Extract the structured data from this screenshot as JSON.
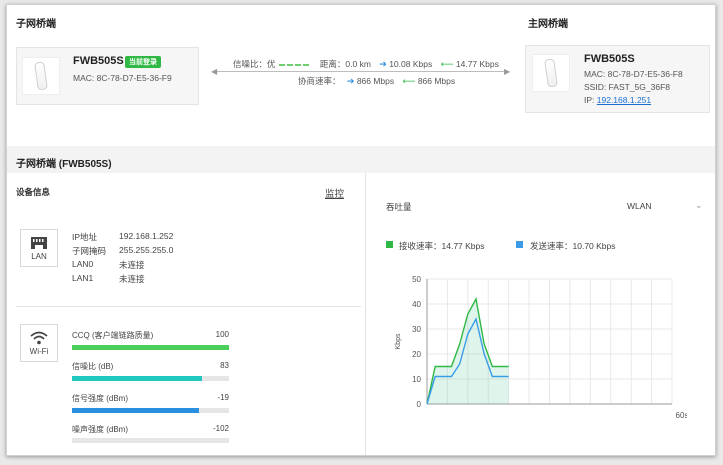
{
  "top": {
    "child_title": "子网桥端",
    "main_title": "主网桥端"
  },
  "child_device": {
    "name": "FWB505S",
    "badge": "当前登录",
    "mac": "MAC: 8C-78-D7-E5-36-F9"
  },
  "main_device": {
    "name": "FWB505S",
    "mac": "MAC: 8C-78-D7-E5-36-F8",
    "ssid": "SSID: FAST_5G_36F8",
    "ip_label": "IP: ",
    "ip_link": "192.168.1.251"
  },
  "connection": {
    "snr_text": "信噪比：优",
    "distance": "距离：0.0 km",
    "tx_rate": "10.08 Kbps",
    "rx_rate": "14.77 Kbps",
    "neg_label": "协商速率：",
    "neg_tx": "866 Mbps",
    "neg_rx": "866 Mbps"
  },
  "section": {
    "title": "子网桥端 (FWB505S)",
    "device_info": "设备信息",
    "monitor_link": "监控"
  },
  "lan": {
    "icon_label": "LAN",
    "rows": [
      {
        "key": "IP地址",
        "value": "192.168.1.252"
      },
      {
        "key": "子网掩码",
        "value": "255.255.255.0"
      },
      {
        "key": "LAN0",
        "value": "未连接"
      },
      {
        "key": "LAN1",
        "value": "未连接"
      }
    ]
  },
  "wifi": {
    "icon_label": "Wi-Fi",
    "metrics": [
      {
        "label": "CCQ (客户端链路质量)",
        "value": "100",
        "fraction": 1.0,
        "color": "#4ccf5a"
      },
      {
        "label": "信噪比 (dB)",
        "value": "83",
        "fraction": 0.83,
        "color": "#21c8bd"
      },
      {
        "label": "信号强度 (dBm)",
        "value": "-19",
        "fraction": 0.81,
        "color": "#2a8fdf"
      },
      {
        "label": "噪声强度 (dBm)",
        "value": "-102",
        "fraction": 0.0,
        "color": "#cccccc"
      }
    ]
  },
  "throughput": {
    "title": "吞吐量",
    "select_value": "WLAN",
    "rx_legend": "接收速率：14.77 Kbps",
    "tx_legend": "发送速率：10.70 Kbps",
    "rx_color": "#2fb944",
    "tx_color": "#3a9ce8"
  },
  "chart_data": {
    "type": "line",
    "ylabel": "Kbps",
    "ylim": [
      0,
      50
    ],
    "yticks": [
      "0",
      "10",
      "20",
      "30",
      "40",
      "50"
    ],
    "x_end_label": "60s",
    "xlim": [
      0,
      60
    ],
    "grid": true,
    "series": [
      {
        "values": [
          [
            0,
            0
          ],
          [
            2,
            15
          ],
          [
            6,
            15
          ],
          [
            8,
            24
          ],
          [
            10,
            36
          ],
          [
            12,
            42
          ],
          [
            14,
            24
          ],
          [
            16,
            15
          ],
          [
            20,
            15
          ]
        ],
        "color": "#2fb944"
      },
      {
        "values": [
          [
            0,
            0
          ],
          [
            2,
            11
          ],
          [
            6,
            11
          ],
          [
            8,
            16
          ],
          [
            10,
            28
          ],
          [
            12,
            34
          ],
          [
            14,
            20
          ],
          [
            16,
            11
          ],
          [
            20,
            11
          ]
        ],
        "color": "#3a9ce8"
      }
    ]
  }
}
